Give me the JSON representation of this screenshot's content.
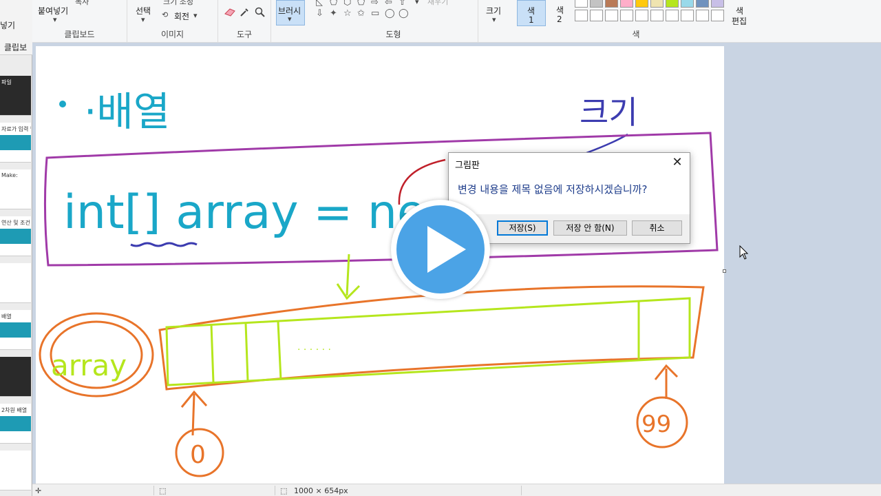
{
  "sidebar": {
    "top_labels": [
      "넣기",
      "클립보"
    ],
    "thumbnails": [
      {
        "text": "파일",
        "style": "dark"
      },
      {
        "text": "자료가 입력 및 출력",
        "style": "band"
      },
      {
        "text": "Make:",
        "style": "plain"
      },
      {
        "text": "연산 및 조건 제어",
        "style": "band"
      },
      {
        "text": "",
        "style": "plain"
      },
      {
        "text": "배열",
        "style": "band"
      },
      {
        "text": "",
        "style": "dark"
      },
      {
        "text": "2차원 배열",
        "style": "band"
      },
      {
        "text": "",
        "style": "plain"
      }
    ]
  },
  "ribbon": {
    "clipboard": {
      "paste_label": "붙여넣기",
      "copy_label": "복사",
      "group_label": "클립보드"
    },
    "image": {
      "select_label": "선택",
      "resize_label": "크기 조정",
      "rotate_label": "회전",
      "group_label": "이미지"
    },
    "tools": {
      "group_label": "도구",
      "icons": [
        "eraser-icon",
        "color-picker-icon",
        "magnifier-icon"
      ]
    },
    "brushes": {
      "label": "브러시"
    },
    "shapes": {
      "group_label": "도형",
      "fill_label": "채우기",
      "row1": [
        "◺",
        "⬠",
        "⬡",
        "⬠",
        "⇨",
        "⇦",
        "⇧"
      ],
      "row2": [
        "⇩",
        "✦",
        "☆",
        "✩",
        "▭",
        "◯",
        "◯"
      ]
    },
    "size": {
      "label": "크기"
    },
    "color1": {
      "label_top": "색",
      "label_bottom": "1"
    },
    "color2": {
      "label_top": "색",
      "label_bottom": "2"
    },
    "colors": {
      "group_label": "색",
      "row1": [
        "#ffffff",
        "#c3c3c3",
        "#b97a57",
        "#ffaec9",
        "#ffc90e",
        "#efe4b0",
        "#b5e61d",
        "#99d9ea",
        "#7092be",
        "#c8bfe7"
      ],
      "row2": [
        "#ffffff",
        "#ffffff",
        "#ffffff",
        "#ffffff",
        "#ffffff",
        "#ffffff",
        "#ffffff",
        "#ffffff",
        "#ffffff",
        "#ffffff"
      ]
    },
    "edit_colors": {
      "label_top": "색",
      "label_bottom": "편집"
    }
  },
  "drawing": {
    "title": "·배열",
    "code": "int[] array = ne",
    "size_note": "크기",
    "array_label": "array",
    "index_start": "0",
    "index_end": "99",
    "ellipsis": "· · · · · ·"
  },
  "dialog": {
    "title": "그림판",
    "message": "변경 내용을 제목 없음에 저장하시겠습니까?",
    "save_button": "저장(S)",
    "dont_save_button": "저장 안 함(N)",
    "cancel_button": "취소"
  },
  "status": {
    "image_size": "1000 × 654px"
  }
}
